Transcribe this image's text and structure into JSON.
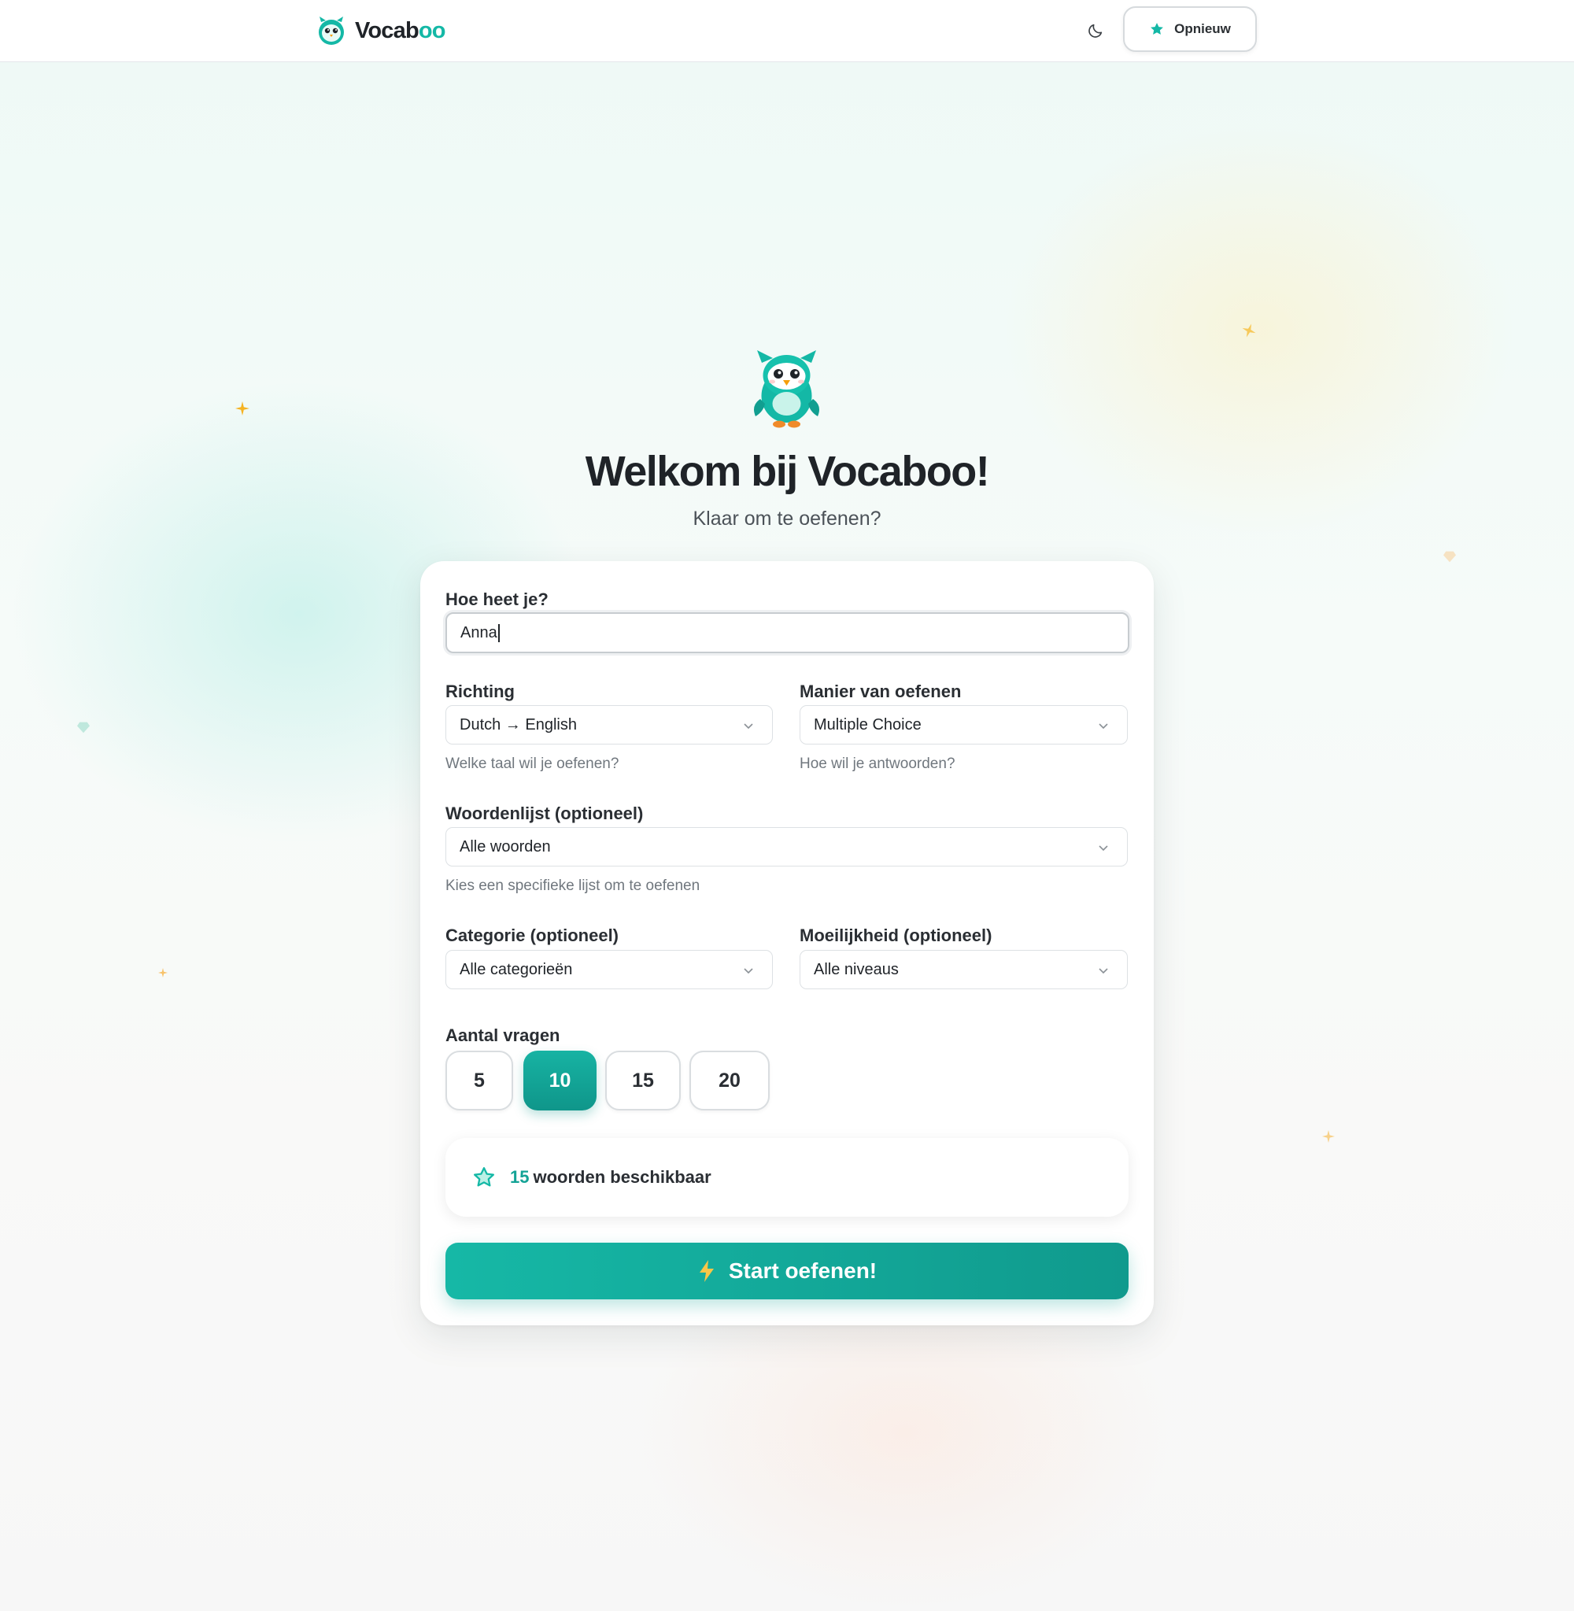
{
  "header": {
    "logo_text_main": "Vocab",
    "logo_text_accent": "oo",
    "restart_label": "Opnieuw"
  },
  "hero": {
    "title": "Welkom bij Vocaboo!",
    "subtitle": "Klaar om te oefenen?"
  },
  "form": {
    "name_label": "Hoe heet je?",
    "name_value": "Anna",
    "direction_label": "Richting",
    "direction_value": "Dutch → English",
    "direction_hint": "Welke taal wil je oefenen?",
    "mode_label": "Manier van oefenen",
    "mode_value": "Multiple Choice",
    "mode_hint": "Hoe wil je antwoorden?",
    "wordlist_label": "Woordenlijst (optioneel)",
    "wordlist_value": "Alle woorden",
    "wordlist_hint": "Kies een specifieke lijst om te oefenen",
    "category_label": "Categorie (optioneel)",
    "category_value": "Alle categorieën",
    "difficulty_label": "Moeilijkheid (optioneel)",
    "difficulty_value": "Alle niveaus",
    "count_label": "Aantal vragen",
    "count_options": [
      "5",
      "10",
      "15",
      "20"
    ],
    "count_selected": "10",
    "available_count": "15",
    "available_text": "woorden beschikbaar",
    "start_label": "Start oefenen!"
  },
  "icons": {
    "logo": "owl-logo-icon",
    "theme": "moon-icon",
    "restart": "star-icon",
    "available": "star-icon",
    "start": "lightning-icon",
    "select": "chevron-down-icon"
  },
  "colors": {
    "accent": "#14b8a6",
    "accent_dark": "#0f968a",
    "spark": "#f5b323",
    "text": "#1f2328"
  }
}
